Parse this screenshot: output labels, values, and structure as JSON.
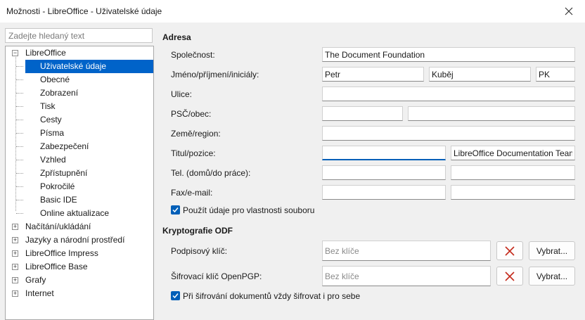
{
  "window": {
    "title": "Možnosti - LibreOffice - Uživatelské údaje"
  },
  "search": {
    "placeholder": "Zadejte hledaný text"
  },
  "tree": {
    "root": "LibreOffice",
    "children": [
      "Uživatelské údaje",
      "Obecné",
      "Zobrazení",
      "Tisk",
      "Cesty",
      "Písma",
      "Zabezpečení",
      "Vzhled",
      "Zpřístupnění",
      "Pokročilé",
      "Basic IDE",
      "Online aktualizace"
    ],
    "others": [
      "Načítání/ukládání",
      "Jazyky a národní prostředí",
      "LibreOffice Impress",
      "LibreOffice Base",
      "Grafy",
      "Internet"
    ]
  },
  "address": {
    "heading": "Adresa",
    "company_label": "Společnost:",
    "company": "The Document Foundation",
    "name_label": "Jméno/příjmení/iniciály:",
    "first_name": "Petr",
    "last_name": "Kuběj",
    "initials": "PK",
    "street_label": "Ulice:",
    "street": "",
    "zip_city_label": "PSČ/obec:",
    "zip": "",
    "city": "",
    "country_label": "Země/region:",
    "country": "",
    "title_label": "Titul/pozice:",
    "title": "",
    "position": "LibreOffice Documentation Team",
    "phone_label": "Tel. (domů/do práce):",
    "phone_home": "",
    "phone_work": "",
    "fax_label": "Fax/e-mail:",
    "fax": "",
    "email": "",
    "use_data_label": "Použít údaje pro vlastnosti souboru",
    "use_data_checked": true
  },
  "crypto": {
    "heading": "Kryptografie ODF",
    "signing_label": "Podpisový klíč:",
    "signing_placeholder": "Bez klíče",
    "encrypt_label": "Šifrovací klíč OpenPGP:",
    "encrypt_placeholder": "Bez klíče",
    "select_label": "Vybrat...",
    "encrypt_self_label": "Při šifrování dokumentů vždy šifrovat i pro sebe",
    "encrypt_self_checked": true
  },
  "colors": {
    "accent": "#005fb8",
    "selection": "#0063c9",
    "clear_icon": "#c42b1c"
  }
}
